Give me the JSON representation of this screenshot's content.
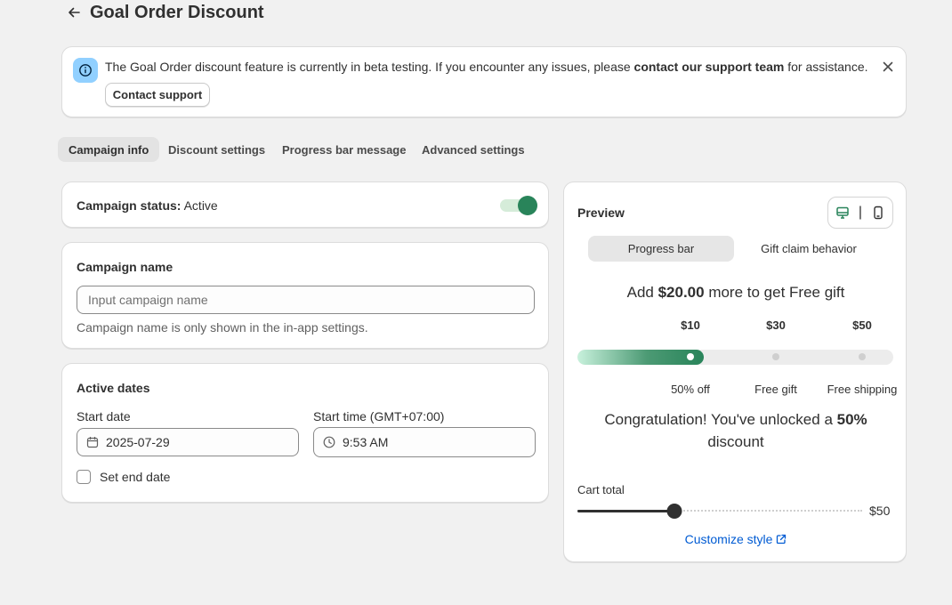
{
  "page": {
    "title": "Goal Order Discount"
  },
  "banner": {
    "text_before": "The Goal Order discount feature is currently in beta testing. If you encounter any issues, please ",
    "text_bold": "contact our support team",
    "text_after": " for assistance.",
    "button_label": "Contact support"
  },
  "tabs": [
    {
      "label": "Campaign info",
      "active": true
    },
    {
      "label": "Discount settings",
      "active": false
    },
    {
      "label": "Progress bar message",
      "active": false
    },
    {
      "label": "Advanced settings",
      "active": false
    }
  ],
  "status": {
    "label": "Campaign status:",
    "value": "Active",
    "enabled": true
  },
  "campaign_name": {
    "heading": "Campaign name",
    "placeholder": "Input campaign name",
    "value": "",
    "help": "Campaign name is only shown in the in-app settings."
  },
  "dates": {
    "heading": "Active dates",
    "start_date_label": "Start date",
    "start_date_value": "2025-07-29",
    "start_time_label": "Start time (GMT+07:00)",
    "start_time_value": "9:53 AM",
    "end_date_label": "Set end date",
    "end_date_checked": false
  },
  "preview": {
    "heading": "Preview",
    "device_divider": "|",
    "segments": [
      {
        "label": "Progress bar",
        "active": true
      },
      {
        "label": "Gift claim behavior",
        "active": false
      }
    ],
    "goal_prefix": "Add ",
    "goal_amount": "$20.00",
    "goal_suffix": " more to get Free gift",
    "progress_fraction": 0.4,
    "milestones": [
      {
        "amount": "$10",
        "reward": "50% off",
        "reached": true
      },
      {
        "amount": "$30",
        "reward": "Free gift",
        "reached": false
      },
      {
        "amount": "$50",
        "reward": "Free shipping",
        "reached": false
      }
    ],
    "congrats_prefix": "Congratulation! You've unlocked a ",
    "congrats_bold": "50%",
    "congrats_suffix": " discount",
    "cart_label": "Cart total",
    "cart_value_fraction": 0.34,
    "cart_max": "$50",
    "customize_label": "Customize style"
  },
  "colors": {
    "accent_green": "#29845a",
    "link_blue": "#005bd3",
    "info_blue": "#91d0ff"
  }
}
